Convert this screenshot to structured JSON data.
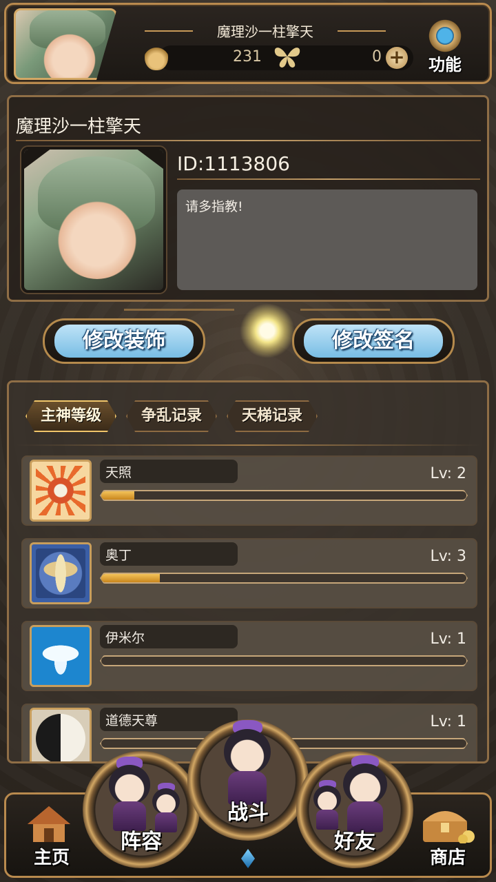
{
  "header": {
    "player_name": "魔理沙一柱擎天",
    "resource_1_value": "231",
    "resource_2_value": "0",
    "plus_label": "+",
    "function_label": "功能",
    "icons": [
      "flame-spirit-icon",
      "butterfly-icon",
      "plus-icon",
      "gear-icon"
    ]
  },
  "profile": {
    "name": "魔理沙一柱擎天",
    "id_text": "ID:1113806",
    "signature": "请多指教!"
  },
  "actions": {
    "edit_decoration": "修改装饰",
    "edit_signature": "修改签名"
  },
  "level_panel": {
    "tabs": [
      {
        "label": "主神等级",
        "active": true
      },
      {
        "label": "争乱记录",
        "active": false
      },
      {
        "label": "天梯记录",
        "active": false
      }
    ],
    "gods": [
      {
        "name": "天照",
        "level": "Lv: 2",
        "progress": 0.09,
        "icon": "sun-icon",
        "color": "#f3c98a"
      },
      {
        "name": "奥丁",
        "level": "Lv: 3",
        "progress": 0.16,
        "icon": "winged-sword-icon",
        "color": "#3b5fa6"
      },
      {
        "name": "伊米尔",
        "level": "Lv: 1",
        "progress": 0.0,
        "icon": "ice-giant-icon",
        "color": "#1d86cf"
      },
      {
        "name": "道德天尊",
        "level": "Lv: 1",
        "progress": 0.0,
        "icon": "yin-yang-icon",
        "color": "#d8cdb8"
      }
    ]
  },
  "bottom_nav": {
    "home": "主页",
    "lineup": "阵容",
    "battle": "战斗",
    "friends": "好友",
    "shop": "商店"
  }
}
